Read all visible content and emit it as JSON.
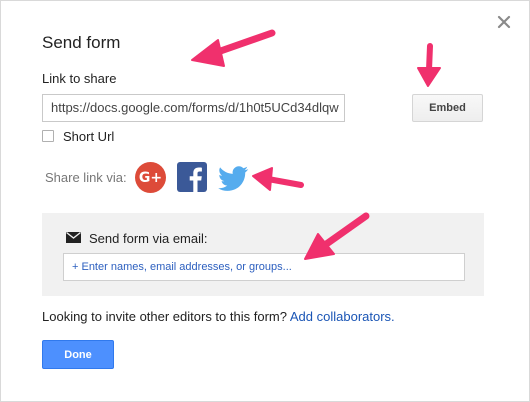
{
  "dialog": {
    "title": "Send form",
    "close_icon": "close-icon"
  },
  "link": {
    "label": "Link to share",
    "url": "https://docs.google.com/forms/d/1h0t5UCd34dlqw",
    "embed_label": "Embed",
    "short_url_label": "Short Url",
    "short_url_checked": false
  },
  "share": {
    "label": "Share link via:",
    "networks": [
      {
        "name": "Google+",
        "icon": "google-plus-icon",
        "glyph": "G+",
        "color": "#dd4b39"
      },
      {
        "name": "Facebook",
        "icon": "facebook-icon",
        "color": "#3b5998"
      },
      {
        "name": "Twitter",
        "icon": "twitter-icon",
        "color": "#55acee"
      }
    ]
  },
  "email": {
    "header": "Send form via email:",
    "icon": "envelope-icon",
    "placeholder": "+ Enter names, email addresses, or groups..."
  },
  "collaborators": {
    "question": "Looking to invite other editors to this form?",
    "link_label": "Add collaborators."
  },
  "footer": {
    "done_label": "Done"
  },
  "colors": {
    "accent": "#4d90fe",
    "link": "#1a55b5",
    "annotation_arrow": "#f0306d"
  }
}
